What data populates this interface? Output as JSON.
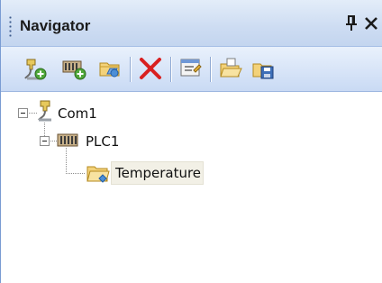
{
  "panel": {
    "title": "Navigator",
    "pin_glyph": "p",
    "close_glyph": "✕"
  },
  "toolbar": {
    "buttons": [
      {
        "name": "add-port",
        "icon": "connector-add-icon"
      },
      {
        "name": "add-device",
        "icon": "device-add-icon"
      },
      {
        "name": "add-group",
        "icon": "folder-add-icon"
      },
      {
        "name": "delete",
        "icon": "delete-icon"
      },
      {
        "name": "properties",
        "icon": "properties-icon"
      },
      {
        "name": "open",
        "icon": "open-folder-icon"
      },
      {
        "name": "save",
        "icon": "save-icon"
      }
    ]
  },
  "tree": {
    "nodes": [
      {
        "label": "Com1",
        "icon": "connector-icon",
        "level": 0,
        "expanded": true
      },
      {
        "label": "PLC1",
        "icon": "plc-device-icon",
        "level": 1,
        "expanded": true
      },
      {
        "label": "Temperature",
        "icon": "tag-folder-icon",
        "level": 2,
        "selected": true
      }
    ]
  },
  "colors": {
    "header_gradient_top": "#e3edf9",
    "header_gradient_bottom": "#c3d5ef",
    "delete_red": "#d92020",
    "selection_bg": "#f2f0e6"
  }
}
